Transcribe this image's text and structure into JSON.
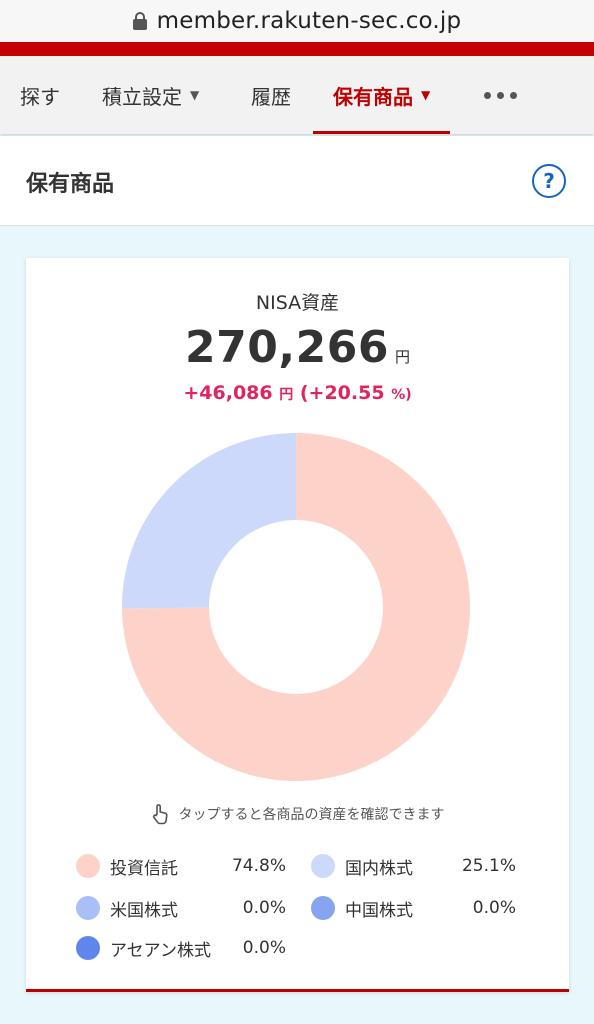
{
  "browser": {
    "url": "member.rakuten-sec.co.jp"
  },
  "nav": {
    "tabs": [
      {
        "label": "探す"
      },
      {
        "label": "積立設定",
        "caret": "▼"
      },
      {
        "label": "履歴"
      },
      {
        "label": "保有商品",
        "caret": "▼"
      }
    ]
  },
  "section": {
    "title": "保有商品",
    "help_glyph": "?"
  },
  "summary": {
    "label": "NISA資産",
    "amount": "270,266",
    "unit": "円",
    "gain": "+46,086",
    "gain_unit": "円",
    "gain_pct_open": "(+20.55",
    "gain_pct_close": "%)",
    "hint": "タップすると各商品の資産を確認できます"
  },
  "legend": [
    {
      "name": "投資信託",
      "pct": "74.8%",
      "color": "#fdd3c9"
    },
    {
      "name": "国内株式",
      "pct": "25.1%",
      "color": "#cdd9fb"
    },
    {
      "name": "米国株式",
      "pct": "0.0%",
      "color": "#a9bff7"
    },
    {
      "name": "中国株式",
      "pct": "0.0%",
      "color": "#86a4f0"
    },
    {
      "name": "アセアン株式",
      "pct": "0.0%",
      "color": "#5f86ea"
    }
  ],
  "chart_data": {
    "type": "pie",
    "categories": [
      "投資信託",
      "国内株式",
      "米国株式",
      "中国株式",
      "アセアン株式"
    ],
    "values": [
      74.8,
      25.1,
      0.0,
      0.0,
      0.0
    ],
    "colors": [
      "#fdd3c9",
      "#cdd9fb",
      "#a9bff7",
      "#86a4f0",
      "#5f86ea"
    ]
  }
}
